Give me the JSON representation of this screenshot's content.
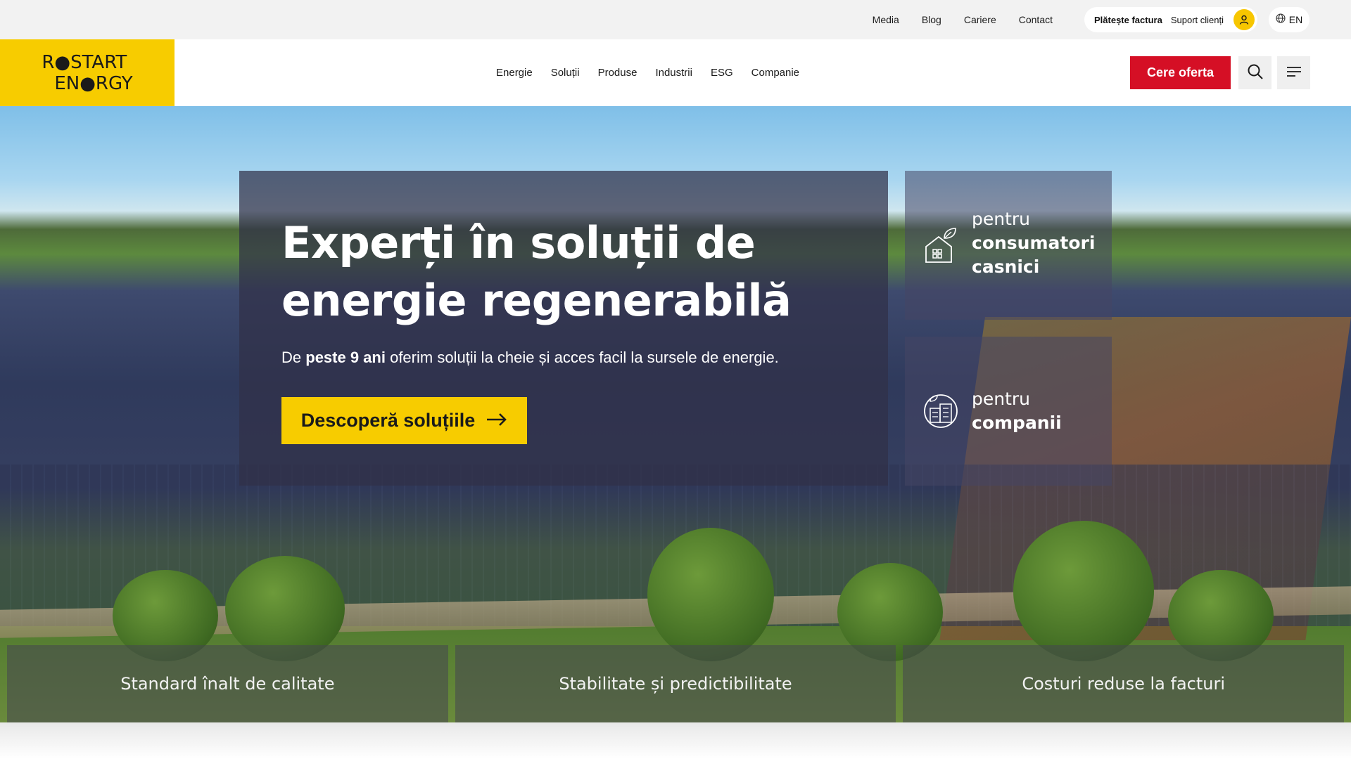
{
  "topbar": {
    "links": [
      "Media",
      "Blog",
      "Cariere",
      "Contact"
    ],
    "pay_bill": "Plătește factura",
    "support": "Suport clienți",
    "language": "EN"
  },
  "header": {
    "logo_line1": "R●START",
    "logo_line2": "EN●RGY",
    "nav": [
      "Energie",
      "Soluții",
      "Produse",
      "Industrii",
      "ESG",
      "Companie"
    ],
    "cta_label": "Cere oferta"
  },
  "hero": {
    "title": "Experți în soluții de energie regenerabilă",
    "subtitle_prefix": "De ",
    "subtitle_bold": "peste 9 ani",
    "subtitle_rest": " oferim soluții la cheie și acces facil la sursele de energie.",
    "button_label": "Descoperă soluțiile"
  },
  "segments": {
    "home_pre": "pentru",
    "home_main_1": "consumatori",
    "home_main_2": "casnici",
    "biz_pre": "pentru",
    "biz_main": "companii"
  },
  "features": [
    "Standard înalt de calitate",
    "Stabilitate și predictibilitate",
    "Costuri reduse la facturi"
  ],
  "colors": {
    "brand_yellow": "#f7cc00",
    "cta_red": "#d50f25"
  }
}
